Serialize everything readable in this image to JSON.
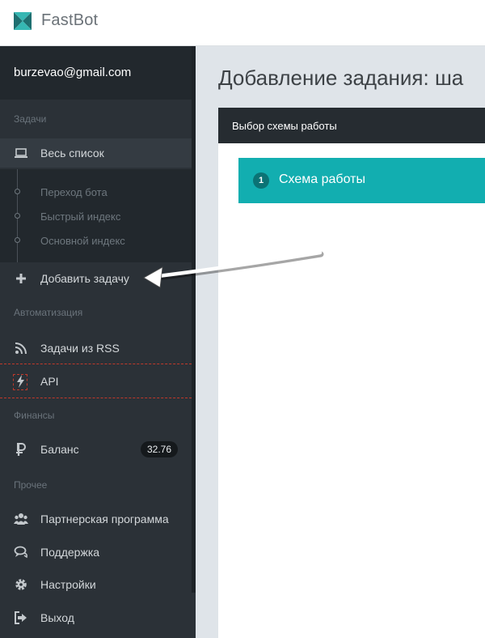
{
  "app": {
    "brand": "FastBot"
  },
  "user": {
    "email": "burzevao@gmail.com"
  },
  "sidebar": {
    "sections": {
      "tasks": "Задачи",
      "automation": "Автоматизация",
      "finance": "Финансы",
      "other": "Прочее"
    },
    "items": {
      "all_list": "Весь список",
      "sub_bot": "Переход бота",
      "sub_fast": "Быстрый индекс",
      "sub_main": "Основной индекс",
      "add_task": "Добавить задачу",
      "rss_tasks": "Задачи из RSS",
      "api": "API",
      "balance": "Баланс",
      "balance_value": "32.76",
      "partner": "Партнерская программа",
      "support": "Поддержка",
      "settings": "Настройки",
      "logout": "Выход"
    }
  },
  "main": {
    "title": "Добавление задания: ша",
    "panel_header": "Выбор схемы работы",
    "step_number": "1",
    "step_label": "Схема работы"
  },
  "colors": {
    "sidebar_bg": "#2b3137",
    "step_accent": "#12aeb0",
    "highlight_red": "#c0392b"
  }
}
